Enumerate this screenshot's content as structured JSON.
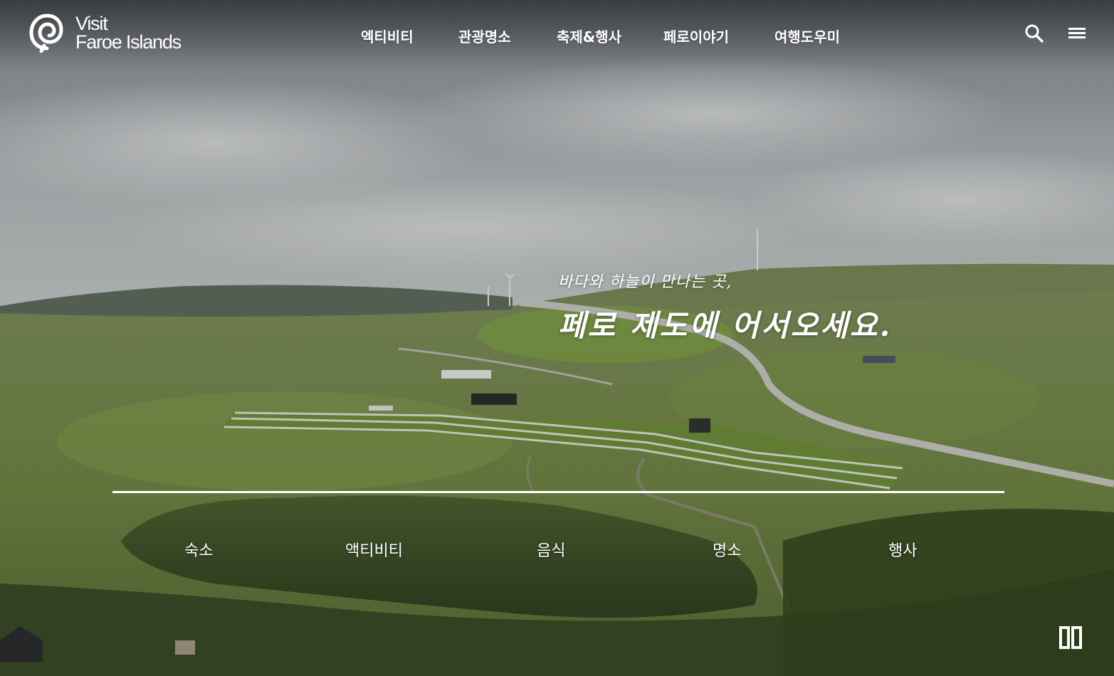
{
  "brand": {
    "logo_line1": "Visit",
    "logo_line2": "Faroe Islands"
  },
  "nav": {
    "items": [
      {
        "label": "엑티비티"
      },
      {
        "label": "관광명소"
      },
      {
        "label": "축제&행사"
      },
      {
        "label": "페로이야기"
      },
      {
        "label": "여행도우미"
      }
    ]
  },
  "header_icons": {
    "search": "search-icon",
    "menu": "hamburger-menu-icon"
  },
  "hero": {
    "subtitle": "바다와 하늘이 만나는 곳,",
    "title": "페로 제도에 어서오세요."
  },
  "quick_links": [
    {
      "label": "숙소"
    },
    {
      "label": "액티비티"
    },
    {
      "label": "음식"
    },
    {
      "label": "명소"
    },
    {
      "label": "행사"
    }
  ],
  "controls": {
    "pause": "pause-icon"
  },
  "colors": {
    "text": "#ffffff",
    "sky": "#9ea3a6",
    "grass": "#6f8a3f",
    "road": "#c9c9c4"
  }
}
